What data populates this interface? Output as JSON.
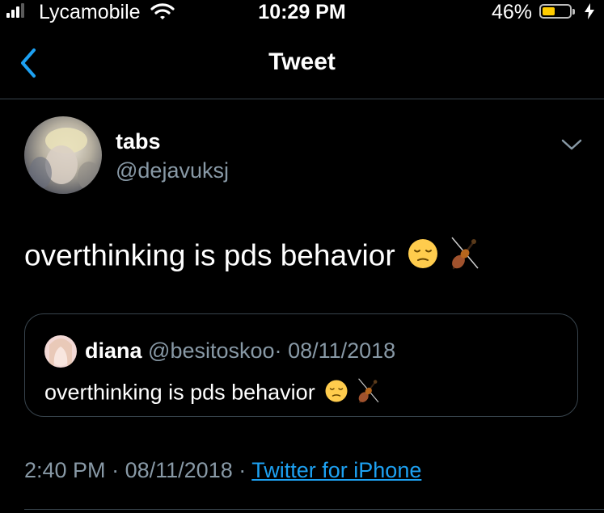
{
  "status_bar": {
    "carrier": "Lycamobile",
    "time": "10:29 PM",
    "battery_percent_text": "46%",
    "battery_level": 0.46,
    "signal_bars": 3,
    "signal_bars_total": 4,
    "wifi_icon": "wifi-icon",
    "charging_icon": "bolt-icon"
  },
  "header": {
    "title": "Tweet",
    "back_icon": "chevron-left-icon"
  },
  "tweet": {
    "display_name": "tabs",
    "handle": "@dejavuksj",
    "text": "overthinking is pds behavior",
    "emojis": [
      "pensive-face-emoji",
      "violin-emoji"
    ],
    "menu_icon": "chevron-down-icon",
    "timestamp": "2:40 PM",
    "date": "08/11/2018",
    "separator": "·",
    "source": "Twitter for iPhone"
  },
  "quoted_tweet": {
    "display_name": "diana",
    "handle": "@besitoskoo",
    "separator": "·",
    "date": "08/11/2018",
    "text": "overthinking is pds behavior",
    "emojis": [
      "pensive-face-emoji",
      "violin-emoji"
    ]
  },
  "colors": {
    "background": "#000000",
    "text_primary": "#ffffff",
    "text_secondary": "#8899a6",
    "accent": "#1da1f2",
    "divider": "#38444d",
    "battery": "#ffcc00"
  }
}
